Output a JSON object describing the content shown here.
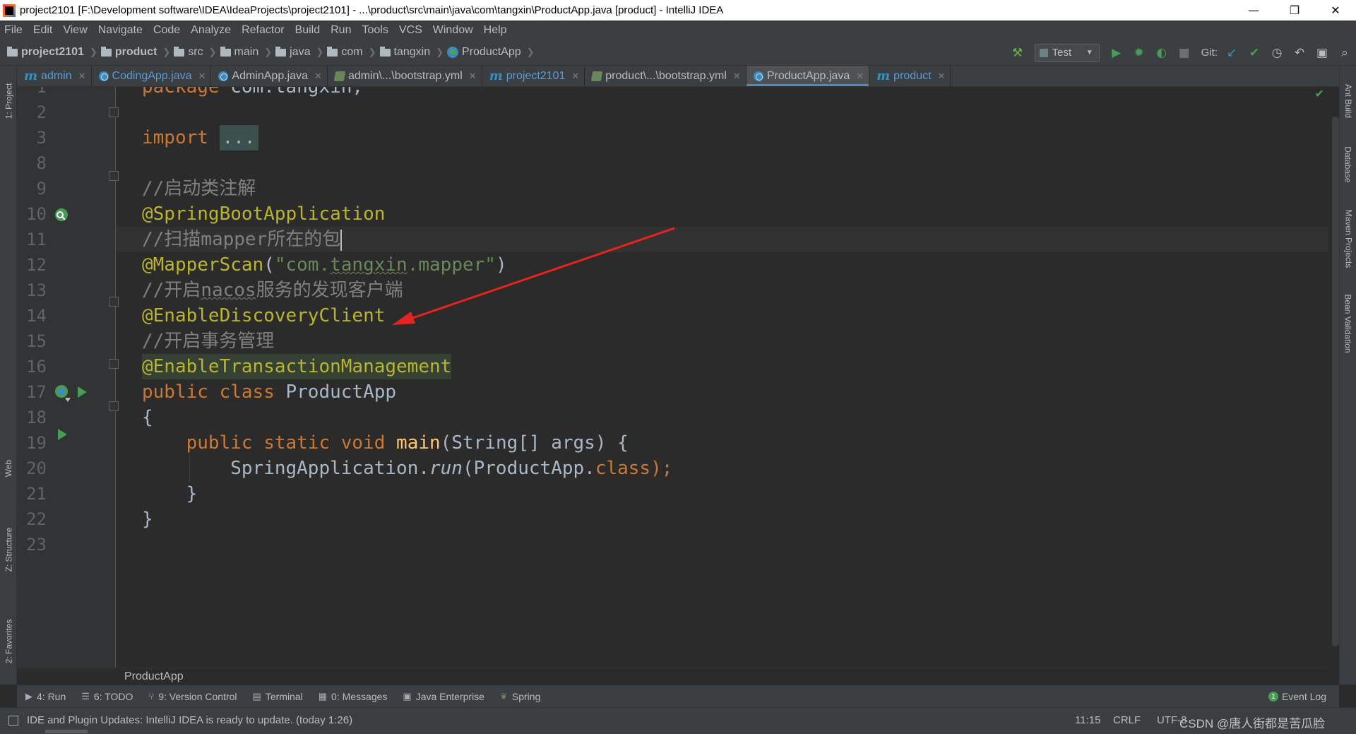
{
  "window": {
    "title": "project2101 [F:\\Development software\\IDEA\\IdeaProjects\\project2101] - ...\\product\\src\\main\\java\\com\\tangxin\\ProductApp.java [product] - IntelliJ IDEA",
    "minimize": "—",
    "restore": "❐",
    "close": "✕"
  },
  "menu": [
    "File",
    "Edit",
    "View",
    "Navigate",
    "Code",
    "Analyze",
    "Refactor",
    "Build",
    "Run",
    "Tools",
    "VCS",
    "Window",
    "Help"
  ],
  "breadcrumbs": [
    "project2101",
    "product",
    "src",
    "main",
    "java",
    "com",
    "tangxin",
    "ProductApp"
  ],
  "toolbar": {
    "run_config": "Test",
    "git_label": "Git:"
  },
  "tabs": [
    {
      "label": "admin",
      "icon": "maven-m-icon"
    },
    {
      "label": "CodingApp.java",
      "icon": "class-icon"
    },
    {
      "label": "AdminApp.java",
      "icon": "class-icon"
    },
    {
      "label": "admin\\...\\bootstrap.yml",
      "icon": "yaml-icon"
    },
    {
      "label": "project2101",
      "icon": "maven-m-icon"
    },
    {
      "label": "product\\...\\bootstrap.yml",
      "icon": "yaml-icon"
    },
    {
      "label": "ProductApp.java",
      "icon": "class-icon",
      "active": true
    },
    {
      "label": "product",
      "icon": "maven-m-icon"
    }
  ],
  "left_tool_windows": [
    "1: Project",
    "Web",
    "Z: Structure",
    "2: Favorites"
  ],
  "right_tool_windows": [
    "Ant Build",
    "Database",
    "Maven Projects",
    "Bean Validation"
  ],
  "editor": {
    "line_numbers": [
      "1",
      "2",
      "3",
      "8",
      "9",
      "10",
      "11",
      "12",
      "13",
      "14",
      "15",
      "16",
      "17",
      "18",
      "19",
      "20",
      "21",
      "22",
      "23"
    ],
    "lines": {
      "l1": {
        "kw": "package",
        "rest": " com.tangxin;"
      },
      "l3": {
        "kw": "import",
        "fold": "..."
      },
      "l9": {
        "comment": "//启动类注解"
      },
      "l10": {
        "ann": "@SpringBootApplication"
      },
      "l11": {
        "comment": "//扫描mapper所在的包"
      },
      "l12": {
        "ann": "@MapperScan",
        "open": "(",
        "str_a": "\"com.",
        "str_b": "tangxin",
        "str_c": ".mapper\"",
        "close": ")"
      },
      "l13": {
        "comment_a": "//开启",
        "comment_b": "nacos",
        "comment_c": "服务的发现客户端"
      },
      "l14": {
        "ann": "@EnableDiscoveryClient"
      },
      "l15": {
        "comment": "//开启事务管理"
      },
      "l16": {
        "ann": "@EnableTransactionManagement"
      },
      "l17": {
        "kw": "public class",
        "rest": " ProductApp"
      },
      "l18": {
        "rest": "{"
      },
      "l19": {
        "indent": "    ",
        "kw": "public static void",
        "fn": "main",
        "rest": "(String[] args) {"
      },
      "l20": {
        "indent": "        ",
        "a": "SpringApplication.",
        "it": "run",
        "b": "(ProductApp.",
        "kw": "class",
        "c": ");"
      },
      "l21": {
        "rest": "    }"
      },
      "l22": {
        "rest": "}"
      }
    }
  },
  "file_breadcrumb": "ProductApp",
  "tool_tabs": [
    {
      "label": "4: Run",
      "icon": "run-icon"
    },
    {
      "label": "6: TODO",
      "icon": "todo-icon"
    },
    {
      "label": "9: Version Control",
      "icon": "vcs-icon"
    },
    {
      "label": "Terminal",
      "icon": "terminal-icon"
    },
    {
      "label": "0: Messages",
      "icon": "messages-icon"
    },
    {
      "label": "Java Enterprise",
      "icon": "java-enterprise-icon"
    },
    {
      "label": "Spring",
      "icon": "spring-icon"
    }
  ],
  "event_log": {
    "count": "1",
    "label": "Event Log"
  },
  "status": {
    "message": "IDE and Plugin Updates: IntelliJ IDEA is ready to update. (today 1:26)",
    "position": "11:15",
    "line_sep": "CRLF",
    "encoding": "UTF-8",
    "watermark": "CSDN @唐人街都是苦瓜脸"
  },
  "colors": {
    "background": "#2b2b2b",
    "keyword": "#cc7832",
    "annotation": "#bbb529",
    "comment": "#808080",
    "string": "#6a8759",
    "arrow": "#e8231d"
  }
}
